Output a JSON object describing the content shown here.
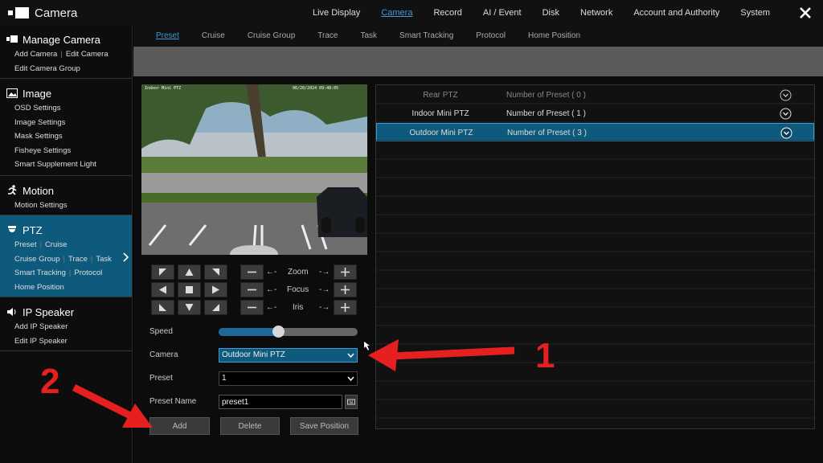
{
  "app": {
    "title": "Camera"
  },
  "topnav": [
    {
      "label": "Live Display",
      "active": false
    },
    {
      "label": "Camera",
      "active": true
    },
    {
      "label": "Record",
      "active": false
    },
    {
      "label": "AI / Event",
      "active": false
    },
    {
      "label": "Disk",
      "active": false
    },
    {
      "label": "Network",
      "active": false
    },
    {
      "label": "Account and Authority",
      "active": false
    },
    {
      "label": "System",
      "active": false
    }
  ],
  "sidebar": {
    "manage_camera": {
      "title": "Manage Camera",
      "rows": [
        [
          "Add Camera",
          "Edit Camera"
        ],
        [
          "Edit Camera Group"
        ]
      ]
    },
    "image": {
      "title": "Image",
      "rows": [
        [
          "OSD Settings"
        ],
        [
          "Image Settings"
        ],
        [
          "Mask Settings"
        ],
        [
          "Fisheye Settings"
        ],
        [
          "Smart Supplement Light"
        ]
      ]
    },
    "motion": {
      "title": "Motion",
      "rows": [
        [
          "Motion Settings"
        ]
      ]
    },
    "ptz": {
      "title": "PTZ",
      "rows": [
        [
          "Preset",
          "Cruise"
        ],
        [
          "Cruise Group",
          "Trace",
          "Task"
        ],
        [
          "Smart Tracking",
          "Protocol"
        ],
        [
          "Home Position"
        ]
      ]
    },
    "ip_speaker": {
      "title": "IP Speaker",
      "rows": [
        [
          "Add IP Speaker"
        ],
        [
          "Edit IP Speaker"
        ]
      ]
    }
  },
  "subtabs": [
    {
      "label": "Preset",
      "active": true
    },
    {
      "label": "Cruise",
      "active": false
    },
    {
      "label": "Cruise Group",
      "active": false
    },
    {
      "label": "Trace",
      "active": false
    },
    {
      "label": "Task",
      "active": false
    },
    {
      "label": "Smart Tracking",
      "active": false
    },
    {
      "label": "Protocol",
      "active": false
    },
    {
      "label": "Home Position",
      "active": false
    }
  ],
  "video": {
    "camera_label": "Indoor Mini PTZ",
    "timestamp": "06/20/2024 09:48:05"
  },
  "controls": {
    "zoom": "Zoom",
    "focus": "Focus",
    "iris": "Iris"
  },
  "form": {
    "speed_label": "Speed",
    "speed_value": 0.43,
    "camera_label": "Camera",
    "camera_value": "Outdoor Mini PTZ",
    "preset_label": "Preset",
    "preset_value": "1",
    "preset_name_label": "Preset Name",
    "preset_name_value": "preset1",
    "add_label": "Add",
    "delete_label": "Delete",
    "save_position_label": "Save Position"
  },
  "camera_list": [
    {
      "name": "Rear PTZ",
      "presets": "Number of Preset ( 0 )",
      "state": "dim"
    },
    {
      "name": "Indoor Mini PTZ",
      "presets": "Number of Preset ( 1 )",
      "state": "normal"
    },
    {
      "name": "Outdoor Mini PTZ",
      "presets": "Number of Preset ( 3 )",
      "state": "selected"
    }
  ],
  "annotations": {
    "step1": "1",
    "step2": "2"
  },
  "colors": {
    "accent": "#3b9ad8",
    "selected_bg": "#0e5a7d",
    "annotation": "#e62020"
  }
}
